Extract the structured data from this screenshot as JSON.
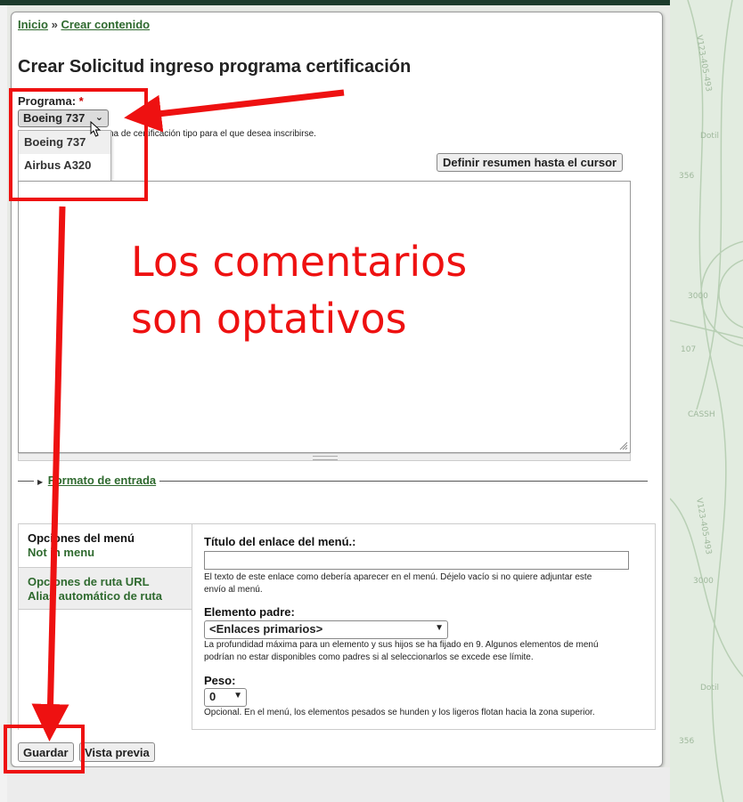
{
  "breadcrumb": {
    "home": "Inicio",
    "separator": "»",
    "current": "Crear contenido"
  },
  "page_title": "Crear Solicitud ingreso programa certificación",
  "programa": {
    "label": "Programa:",
    "required_mark": "*",
    "selected": "Boeing 737",
    "options": [
      "Boeing 737",
      "Airbus A320"
    ],
    "description_tail": "na de certificación tipo para el que desea inscribirse."
  },
  "summary_button": "Definir resumen hasta el cursor",
  "annotation": {
    "line1": "Los comentarios",
    "line2": "son optativos",
    "color": "#ee1111"
  },
  "format_legend": "Formato de entrada",
  "vertical_tabs": [
    {
      "title": "Opciones del menú",
      "summary": "Not in menu"
    },
    {
      "title": "Opciones de ruta URL",
      "summary": "Alias automático de ruta"
    }
  ],
  "menu_settings": {
    "link_title_label": "Título del enlace del menú.:",
    "link_title_value": "",
    "link_title_desc_1": "El texto de este enlace como debería aparecer en el menú. Déjelo vacío si no quiere adjuntar este",
    "link_title_desc_2": "envío al menú.",
    "parent_label": "Elemento padre:",
    "parent_value": "<Enlaces primarios>",
    "parent_desc_1": "La profundidad máxima para un elemento y sus hijos se ha fijado en 9. Algunos elementos de menú",
    "parent_desc_2": "podrían no estar disponibles como padres si al seleccionarlos se excede ese límite.",
    "weight_label": "Peso:",
    "weight_value": "0",
    "weight_desc": "Opcional. En el menú, los elementos pesados se hunden y los ligeros flotan hacia la zona superior."
  },
  "buttons": {
    "save": "Guardar",
    "preview": "Vista previa"
  },
  "colors": {
    "link_green": "#2f6a2f",
    "annotation_red": "#ee1111",
    "header_dark": "#1d3b2c"
  }
}
